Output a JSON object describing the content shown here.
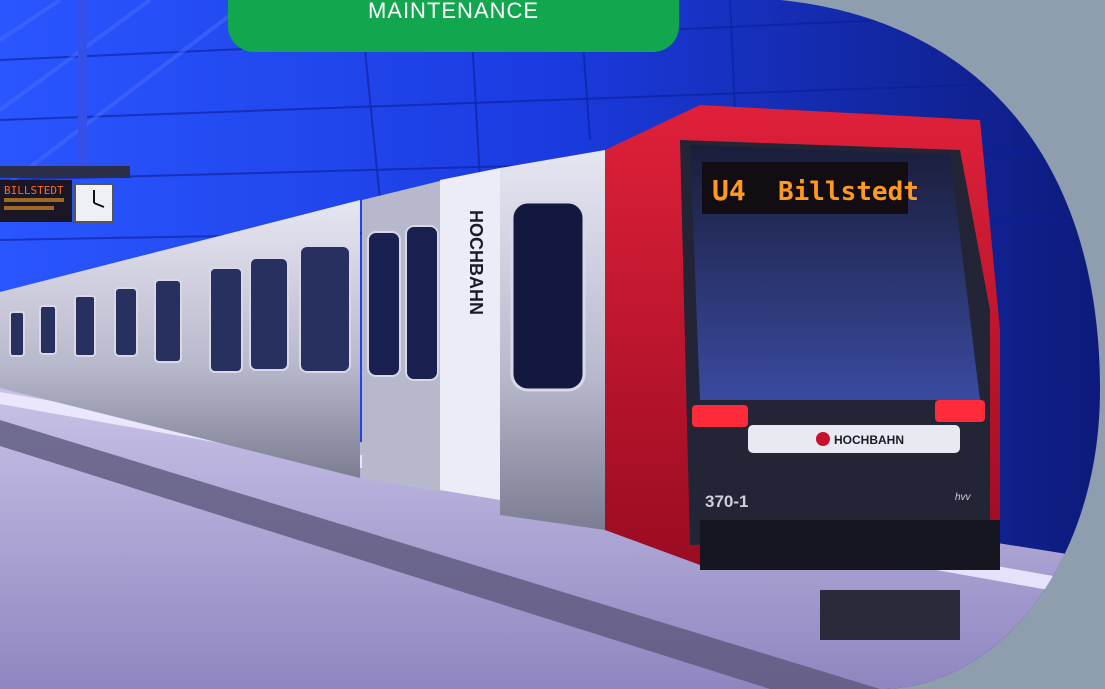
{
  "badge": {
    "label": "MAINTENANCE",
    "color": "#12a64e"
  },
  "photo": {
    "destination_sign": {
      "line": "U4",
      "destination": "Billstedt"
    },
    "platform_sign": {
      "text": "BILLSTEDT"
    },
    "side_logo": "HOCHBAHN",
    "front_logo": "HOCHBAHN",
    "car_number": "370-1",
    "brand_mark": "hvv"
  },
  "colors": {
    "background": "#8e9eae",
    "train_red": "#c8102e",
    "led_amber": "#ff9a1f",
    "wall_blue": "#1d3fd6"
  }
}
